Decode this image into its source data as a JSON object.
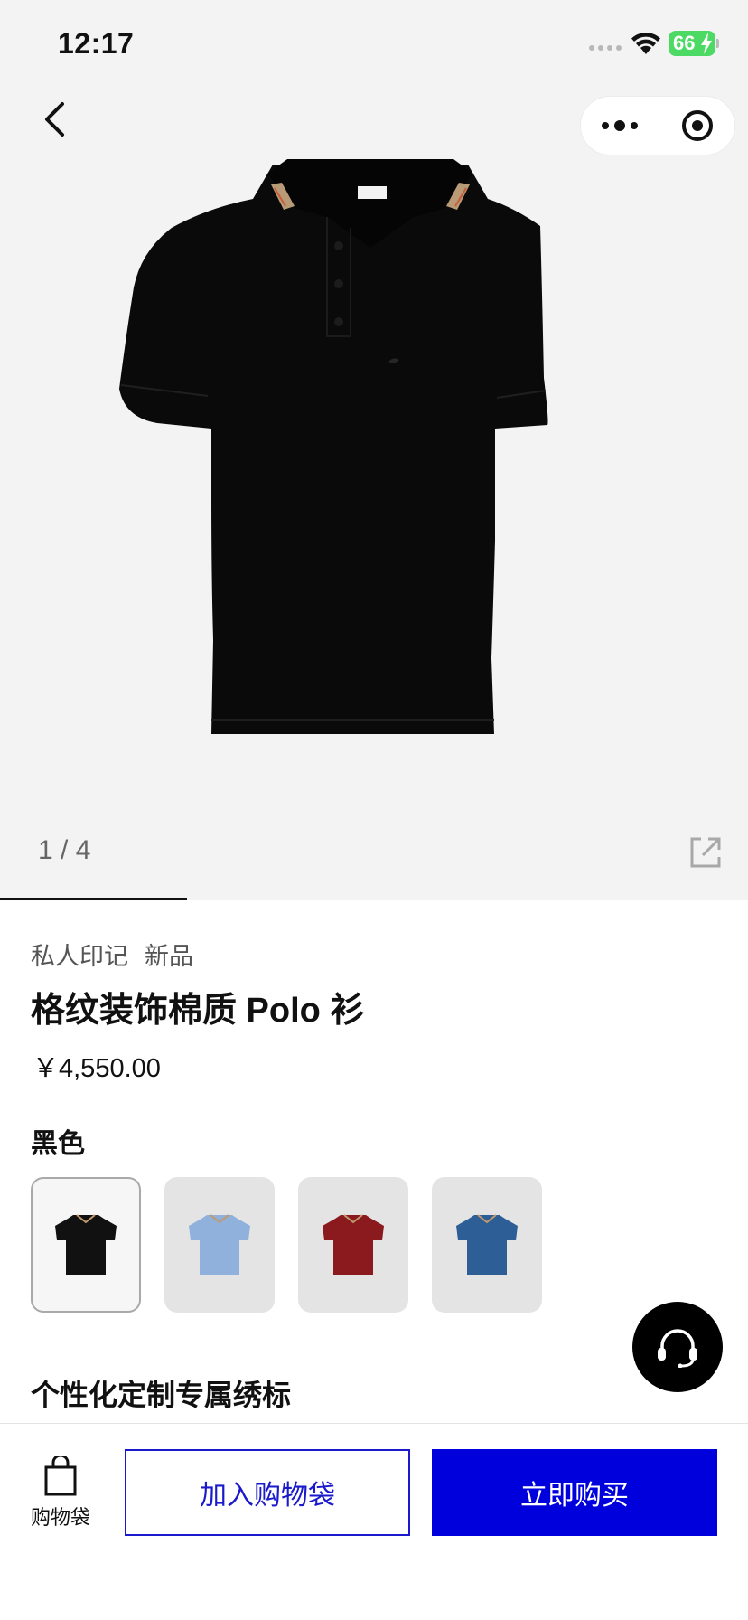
{
  "status_bar": {
    "time": "12:17",
    "battery": "66"
  },
  "gallery": {
    "counter": "1 / 4",
    "progress": 0.25
  },
  "product": {
    "tags": [
      "私人印记",
      "新品"
    ],
    "title": "格纹装饰棉质 Polo 衫",
    "price": "￥4,550.00",
    "color_label": "黑色"
  },
  "swatches": [
    {
      "color": "#111111",
      "selected": true
    },
    {
      "color": "#8fb1dc",
      "selected": false
    },
    {
      "color": "#8b1a1f",
      "selected": false
    },
    {
      "color": "#2d5e96",
      "selected": false
    }
  ],
  "sections": {
    "personalize_title": "个性化定制专属绣标"
  },
  "bottom_bar": {
    "bag_label": "购物袋",
    "add_to_bag_label": "加入购物袋",
    "buy_now_label": "立即购买"
  },
  "colors": {
    "accent": "#0000dd",
    "accent_border": "#1a1acc",
    "gallery_bg": "#f3f3f3"
  },
  "icons": [
    "back-icon",
    "more-icon",
    "target-icon",
    "share-icon",
    "headset-icon",
    "shopping-bag-icon",
    "wifi-icon",
    "battery-icon"
  ]
}
